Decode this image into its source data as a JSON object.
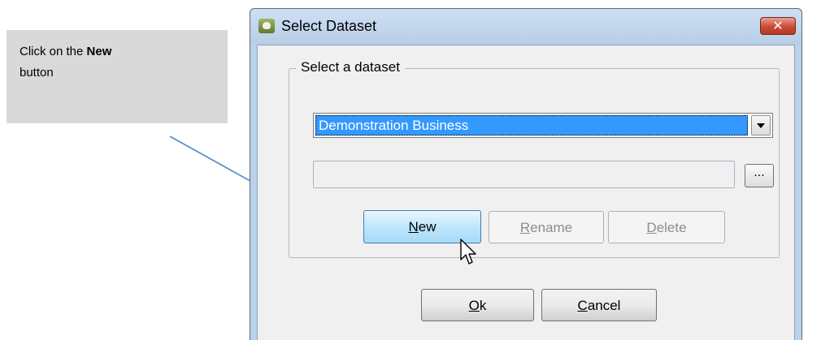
{
  "callout": {
    "prefix": "Click on the ",
    "emphasis": "New",
    "suffix": " button"
  },
  "dialog": {
    "title": "Select Dataset",
    "close_label": "✕",
    "group_label": "Select a dataset",
    "dataset_select": {
      "selected": "Demonstration Business"
    },
    "path_field": {
      "value": ""
    },
    "browse_label": "...",
    "buttons": {
      "new": {
        "label": "New",
        "mnemonic": "N",
        "rest": "ew"
      },
      "rename": {
        "label": "Rename",
        "mnemonic": "R",
        "rest": "ename"
      },
      "delete": {
        "label": "Delete",
        "mnemonic": "D",
        "rest": "elete"
      },
      "ok": {
        "label": "Ok",
        "mnemonic": "O",
        "rest": "k"
      },
      "cancel": {
        "label": "Cancel",
        "mnemonic": "C",
        "rest": "ancel"
      }
    }
  },
  "colors": {
    "selection": "#3399ff",
    "arrow": "#4f8ac9",
    "callout_bg": "#d9d9d9"
  },
  "icons": [
    "app-icon",
    "close-icon",
    "chevron-down-icon",
    "mouse-cursor-icon"
  ]
}
